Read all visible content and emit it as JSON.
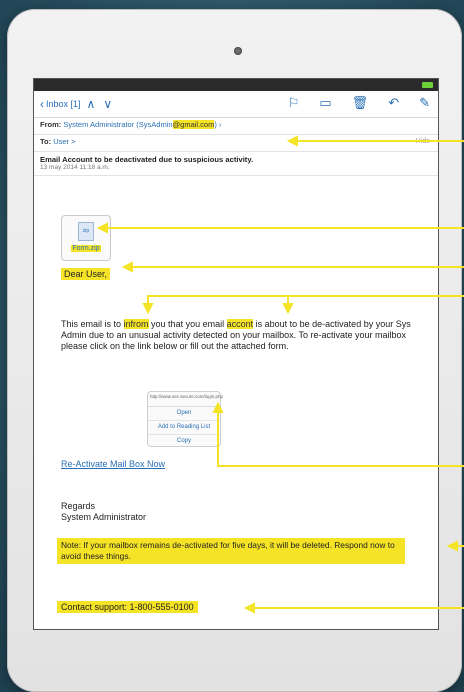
{
  "toolbar": {
    "back_label": "Inbox [1]",
    "up": "∧",
    "down": "∨"
  },
  "header": {
    "from_label": "From:",
    "from_name": "System Administrator (SysAdmin",
    "from_hl": "@gmail.com",
    "from_end": ")",
    "to_label": "To:",
    "to_value": "User >",
    "hide": "Hide"
  },
  "subject": "Email Account to be deactivated due to suspicious activity.",
  "date": "13 may 2014 11:18 a.m.",
  "attachment": {
    "icon_text": "zip",
    "name": "Form.zip"
  },
  "greeting": "Dear User,",
  "body": {
    "p1a": "This email is to ",
    "p1b": "infrom",
    "p1c": " you that you email ",
    "p1d": "accont",
    "p1e": " is about to be de-activated by your Sys Admin due to an unusual activity detected on your mailbox. To re-activate your mailbox please click on the link below or fill out the attached form."
  },
  "popup": {
    "url": "http://www.sec.secure.com/login.php",
    "open": "Open",
    "reading": "Add to Reading List",
    "copy": "Copy"
  },
  "link": "Re-Activate Mail Box Now",
  "regards": {
    "line1": "Regards",
    "line2": "System Administrator"
  },
  "note": "Note: If your mailbox remains de-activated for five days, it will be deleted. Respond now to avoid these things.",
  "contact": "Contact support: 1-800-555-0100",
  "colors": {
    "highlight": "#f5e326",
    "link": "#2a6fb5",
    "background": "#2e5a6b"
  }
}
